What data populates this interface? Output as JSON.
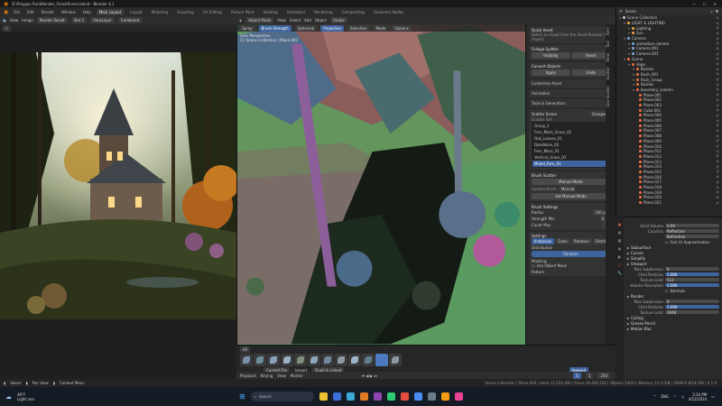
{
  "window": {
    "title": "D:\\Polygon Run\\Blender_ForestScene.blend - Blender 4.1",
    "controls": [
      "—",
      "☐",
      "✕"
    ]
  },
  "menubar": {
    "menus": [
      "File",
      "Edit",
      "Render",
      "Window",
      "Help"
    ],
    "workspaces": [
      "Main Layout",
      "Layout",
      "Modeling",
      "Sculpting",
      "UV Editing",
      "Texture Paint",
      "Shading",
      "Animation",
      "Rendering",
      "Compositing",
      "Geometry Nodes"
    ],
    "active_workspace": "Main Layout",
    "scene": "Scene",
    "view_layer": "ViewLayer"
  },
  "left_editor": {
    "header": [
      "View",
      "Image",
      "Render Result"
    ],
    "slot": "Slot 1",
    "layer": "ViewLayer",
    "pass": "Combined"
  },
  "viewport": {
    "header": [
      "Object Mode",
      "View",
      "Select",
      "Add",
      "Object"
    ],
    "orientation": "Global",
    "tools": [
      "Spray",
      "Brush Strength",
      "Spherical",
      "Projection",
      "Selection",
      "Mode",
      "Options"
    ],
    "label_line1": "User Perspective",
    "label_line2": "(1) Scene Collection | Plane.003",
    "view_mode": "Flat"
  },
  "npanel": {
    "sec1_title": "Quick Asset",
    "sec1_desc": "Select an Asset from the Asset Browser to import.",
    "sec2_title": "Foliage Splitter",
    "sec2_btns": [
      "Visibility",
      "Reset"
    ],
    "sec3_title": "Convert Objects",
    "sec3_btns": [
      "Apply",
      "Undo"
    ],
    "sec4": [
      "Customize Asset",
      "Animation",
      "Tools & Generators"
    ],
    "scatter_title": "Scatter Scene",
    "scatter_mode": "Grouped",
    "scatter_label": "Scatter Set",
    "groups": [
      "Group_1",
      "Fern_Moss_Grass_01",
      "Oak_Leaves_01",
      "Dandelion_02",
      "Fern_Moss_01",
      "Vertical_Grass_01",
      "Mixed_Fern_01"
    ],
    "selected_group": "Mixed_Fern_01",
    "brush_title": "Brush Scatter",
    "brush_mode": "Manual Mode",
    "brush_label": "Current Brush",
    "brush_value": "Manual",
    "brush_btn": "Set Manual Mode",
    "settings_title": "Brush Settings",
    "settings_fields": [
      "Radius",
      "Strength Min",
      "Count Max"
    ],
    "settings_values": [
      "100 px",
      "0.5",
      "5"
    ],
    "layers_title": "Settings",
    "layer_tabs": [
      "Instances",
      "Scale",
      "Rotation",
      "Distribution"
    ],
    "distribution": "Distribution",
    "distribution_val": "Random",
    "masking": "Masking",
    "mask_val": "Use Object Mask",
    "pattern": "Pattern"
  },
  "tabs": [
    "Item",
    "Tool",
    "View",
    "Scatter",
    "Geo-Scatter"
  ],
  "outliner": {
    "header_label": "Scene",
    "items": [
      {
        "name": "Scene Collection",
        "depth": 0,
        "color": "#bfbfbf"
      },
      {
        "name": "LIGHT & LIGHTING",
        "depth": 1,
        "color": "#e0a040"
      },
      {
        "name": "Lighting",
        "depth": 2,
        "color": "#e0a040"
      },
      {
        "name": "Sun",
        "depth": 2,
        "color": "#e0a040"
      },
      {
        "name": "Camera",
        "depth": 1,
        "color": "#6fa0d0"
      },
      {
        "name": "animation camera",
        "depth": 2,
        "color": "#6fa0d0"
      },
      {
        "name": "Camera.001",
        "depth": 2,
        "color": "#6fa0d0"
      },
      {
        "name": "Camera.002",
        "depth": 2,
        "color": "#6fa0d0"
      },
      {
        "name": "Scene",
        "depth": 1,
        "color": "#e06a40"
      },
      {
        "name": "Vege",
        "depth": 2,
        "color": "#e06a40"
      },
      {
        "name": "Bushes",
        "depth": 3,
        "color": "#e06a40"
      },
      {
        "name": "Bush_001",
        "depth": 3,
        "color": "#e06a40"
      },
      {
        "name": "Rock_Group",
        "depth": 3,
        "color": "#e06a40"
      },
      {
        "name": "Bushes",
        "depth": 3,
        "color": "#e06a40"
      },
      {
        "name": "boundary_column",
        "depth": 3,
        "color": "#e06a40"
      },
      {
        "name": "Plane.001",
        "depth": 4,
        "color": "#e06a40"
      },
      {
        "name": "Plane.002",
        "depth": 4,
        "color": "#e06a40"
      },
      {
        "name": "Plane.003",
        "depth": 4,
        "color": "#e06a40"
      },
      {
        "name": "Cube.001",
        "depth": 4,
        "color": "#e06a40"
      },
      {
        "name": "Plane.004",
        "depth": 4,
        "color": "#e06a40"
      },
      {
        "name": "Plane.005",
        "depth": 4,
        "color": "#e06a40"
      },
      {
        "name": "Plane.006",
        "depth": 4,
        "color": "#e06a40"
      },
      {
        "name": "Plane.007",
        "depth": 4,
        "color": "#e06a40"
      },
      {
        "name": "Plane.008",
        "depth": 4,
        "color": "#e06a40"
      },
      {
        "name": "Plane.009",
        "depth": 4,
        "color": "#e06a40"
      },
      {
        "name": "Plane.010",
        "depth": 4,
        "color": "#e06a40"
      },
      {
        "name": "Plane.011",
        "depth": 4,
        "color": "#e06a40"
      },
      {
        "name": "Plane.012",
        "depth": 4,
        "color": "#e06a40"
      },
      {
        "name": "Plane.013",
        "depth": 4,
        "color": "#e06a40"
      },
      {
        "name": "Plane.014",
        "depth": 4,
        "color": "#e06a40"
      },
      {
        "name": "Plane.015",
        "depth": 4,
        "color": "#e06a40"
      },
      {
        "name": "Plane.016",
        "depth": 4,
        "color": "#e06a40"
      },
      {
        "name": "Plane.017",
        "depth": 4,
        "color": "#e06a40"
      },
      {
        "name": "Plane.018",
        "depth": 4,
        "color": "#e06a40"
      },
      {
        "name": "Plane.019",
        "depth": 4,
        "color": "#e06a40"
      },
      {
        "name": "Plane.020",
        "depth": 4,
        "color": "#e06a40"
      },
      {
        "name": "Plane.021",
        "depth": 4,
        "color": "#e06a40"
      }
    ]
  },
  "properties": {
    "rows": [
      {
        "type": "field",
        "label": "Shell Volume",
        "value": "0.00"
      },
      {
        "type": "field",
        "label": "Caustics",
        "value": "Reflective"
      },
      {
        "type": "field",
        "label": "",
        "value": "Refractive"
      },
      {
        "type": "check",
        "label": "Fast GI Approximation"
      },
      {
        "type": "head",
        "label": "Subsurface"
      },
      {
        "type": "head",
        "label": "Curves"
      },
      {
        "type": "head",
        "label": "Simplify"
      },
      {
        "type": "head",
        "label": "Viewport"
      },
      {
        "type": "field",
        "label": "Max Subdivision",
        "value": "6"
      },
      {
        "type": "field",
        "label": "Child Particles",
        "value": "1.000"
      },
      {
        "type": "field",
        "label": "Texture Limit",
        "value": "512"
      },
      {
        "type": "field",
        "label": "Volume Resolution",
        "value": "1.000"
      },
      {
        "type": "check",
        "label": "Normals"
      },
      {
        "type": "head",
        "label": "Render"
      },
      {
        "type": "field",
        "label": "Max Subdivision",
        "value": "6"
      },
      {
        "type": "field",
        "label": "Child Particles",
        "value": "1.000"
      },
      {
        "type": "field",
        "label": "Texture Limit",
        "value": "2048"
      },
      {
        "type": "head",
        "label": "Culling"
      },
      {
        "type": "head",
        "label": "Grease Pencil"
      },
      {
        "type": "head",
        "label": "Motion Blur"
      }
    ]
  },
  "assetbar": {
    "label": "All",
    "count": 12,
    "selected": 10,
    "bottom": [
      "Current File",
      "Import",
      "Dupli & Linked",
      "Append"
    ]
  },
  "timeline": {
    "items": [
      "Playback",
      "Keying",
      "View",
      "Marker"
    ],
    "frame": "1",
    "start": "1",
    "end": "250"
  },
  "statusbar": {
    "items": [
      "Select",
      "Pan View",
      "Context Menu"
    ],
    "right": "Scene Collection | Plane.003 | Verts 12,524,300 | Faces 10,400,210 | Objects 1/620 | Memory 12.4 GiB | VRAM 6.8/24 GiB | 4.1.0"
  },
  "taskbar": {
    "temp": "46°F",
    "weather": "Light rain",
    "search_placeholder": "Search",
    "apps": [
      "#f1c232",
      "#3b6fd6",
      "#3aaad9",
      "#e07b24",
      "#8e44ad",
      "#2ecc71",
      "#e74c3c",
      "#4b8bf4",
      "#6c7a89",
      "#f39c12",
      "#e84393"
    ],
    "time": "3:14 PM",
    "date": "4/12/2024",
    "lang": "ENG"
  },
  "colors": {
    "accent": "#3e64a0",
    "viewport_bg": "#5a9a60",
    "outliner_mesh": "#e06a40"
  }
}
